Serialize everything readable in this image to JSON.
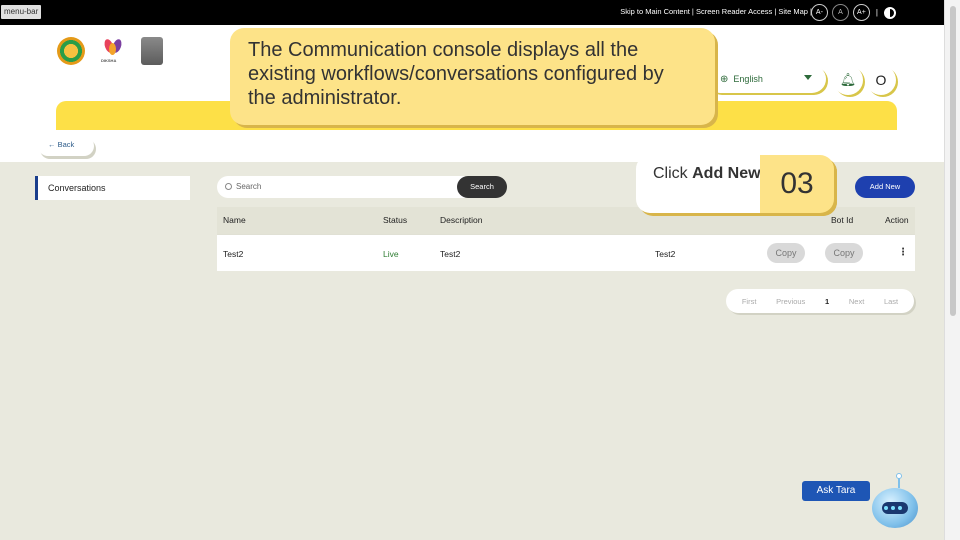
{
  "topbar": {
    "menu_bar_label": "menu-bar",
    "links": "Skip to Main Content | Screen Reader Access | Site Map |",
    "font_decrease": "A-",
    "font_normal": "A",
    "font_increase": "A+",
    "separator": "|"
  },
  "header": {
    "diksha_logo_text": "DIKSHA",
    "language": "English",
    "avatar_initial": "O"
  },
  "tooltip": {
    "text": "The Communication console displays all the existing workflows/conversations configured by the administrator."
  },
  "back": {
    "label": "← Back"
  },
  "sidebar": {
    "items": [
      {
        "label": "Conversations"
      }
    ]
  },
  "search": {
    "placeholder": "Search",
    "button": "Search"
  },
  "add_new": {
    "label": "Add New"
  },
  "step": {
    "prefix": "Click ",
    "bold": "Add New",
    "number": "03"
  },
  "table": {
    "headers": {
      "name": "Name",
      "status": "Status",
      "description": "Description",
      "bot_id": "Bot Id",
      "action": "Action"
    },
    "rows": [
      {
        "name": "Test2",
        "status": "Live",
        "description": "Test2",
        "col4": "Test2",
        "copy1": "Copy",
        "copy2": "Copy",
        "action": "⋮"
      }
    ]
  },
  "pagination": {
    "first": "First",
    "previous": "Previous",
    "current": "1",
    "next": "Next",
    "last": "Last"
  },
  "assistant": {
    "label": "Ask Tara"
  },
  "colors": {
    "accent_blue": "#1e40af",
    "banner_yellow": "#fde047",
    "live_green": "#2e7d32"
  }
}
